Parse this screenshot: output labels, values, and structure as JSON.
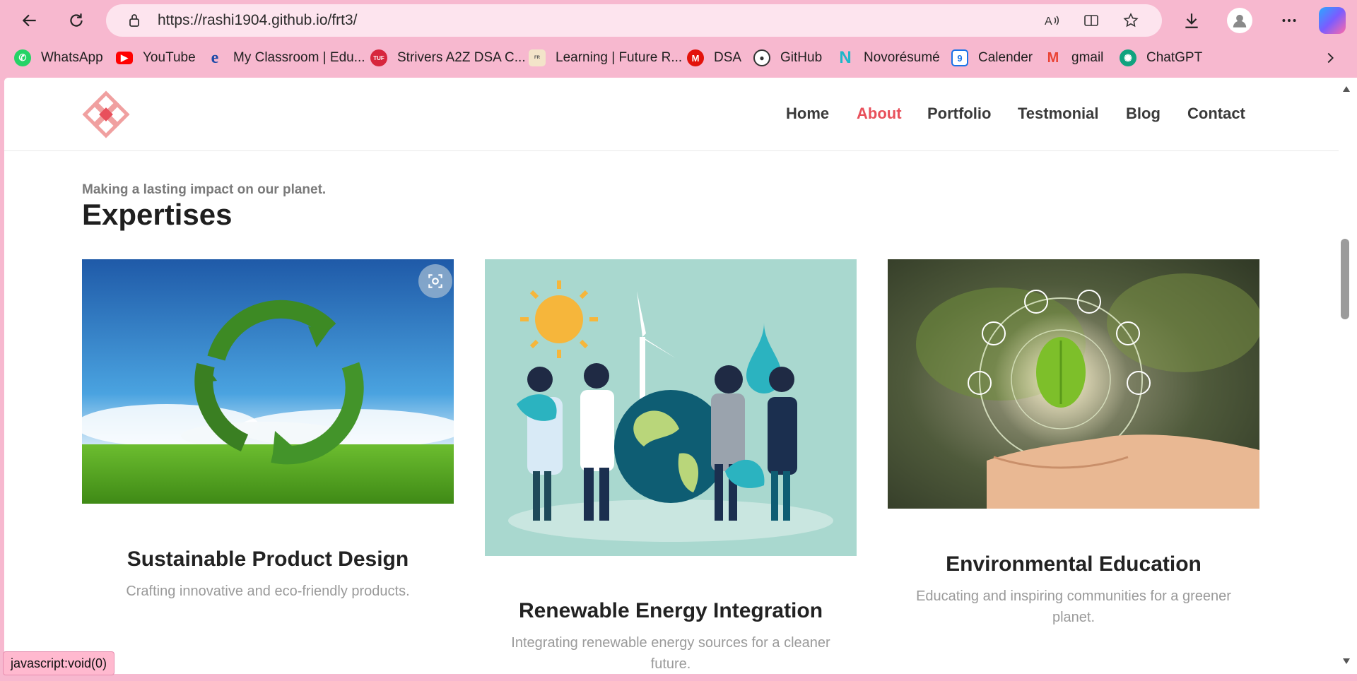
{
  "browser": {
    "url": "https://rashi1904.github.io/frt3/",
    "bookmarks": [
      {
        "label": "WhatsApp",
        "icon": "whatsapp-icon",
        "color": "#25d366"
      },
      {
        "label": "YouTube",
        "icon": "youtube-icon",
        "color": "#ff0000"
      },
      {
        "label": "My Classroom | Edu...",
        "icon": "edureka-icon",
        "color": "#1f4aa8"
      },
      {
        "label": "Strivers A2Z DSA C...",
        "icon": "tuf-icon",
        "color": "#d7263d"
      },
      {
        "label": "Learning | Future R...",
        "icon": "future-ready-icon",
        "color": "#e6a23c"
      },
      {
        "label": "DSA",
        "icon": "dsa-icon",
        "color": "#e3120b"
      },
      {
        "label": "GitHub",
        "icon": "github-icon",
        "color": "#ffffff"
      },
      {
        "label": "Novorésumé",
        "icon": "novoresume-icon",
        "color": "#1fb6c9"
      },
      {
        "label": "Calender",
        "icon": "calendar-icon",
        "color": "#1a73e8"
      },
      {
        "label": "gmail",
        "icon": "gmail-icon",
        "color": "#ea4335"
      },
      {
        "label": "ChatGPT",
        "icon": "chatgpt-icon",
        "color": "#10a37f"
      }
    ],
    "status_text": "javascript:void(0)"
  },
  "site": {
    "nav": [
      "Home",
      "About",
      "Portfolio",
      "Testmonial",
      "Blog",
      "Contact"
    ],
    "active_nav": "About",
    "accent_color": "#e8505b",
    "section_subtitle": "Making a lasting impact on our planet.",
    "section_title": "Expertises",
    "cards": [
      {
        "title": "Sustainable Product Design",
        "description": "Crafting innovative and eco-friendly products.",
        "image": "recycle-grass-image"
      },
      {
        "title": "Renewable Energy Integration",
        "description": "Integrating renewable energy sources for a cleaner future.",
        "image": "people-earth-illustration"
      },
      {
        "title": "Environmental Education",
        "description": "Educating and inspiring communities for a greener planet.",
        "image": "hand-leaf-image"
      }
    ]
  }
}
